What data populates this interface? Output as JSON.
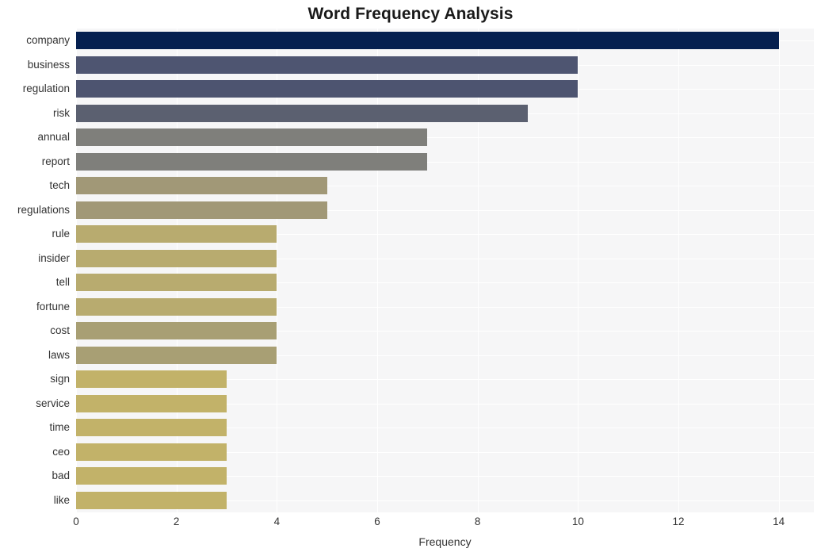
{
  "chart_data": {
    "type": "bar",
    "orientation": "horizontal",
    "title": "Word Frequency Analysis",
    "xlabel": "Frequency",
    "ylabel": "",
    "categories": [
      "company",
      "business",
      "regulation",
      "risk",
      "annual",
      "report",
      "tech",
      "regulations",
      "rule",
      "insider",
      "tell",
      "fortune",
      "cost",
      "laws",
      "sign",
      "service",
      "time",
      "ceo",
      "bad",
      "like"
    ],
    "values": [
      14,
      10,
      10,
      9,
      7,
      7,
      5,
      5,
      4,
      4,
      4,
      4,
      4,
      4,
      3,
      3,
      3,
      3,
      3,
      3
    ],
    "bar_colors": [
      "#052050",
      "#4e5571",
      "#4d5470",
      "#5b6070",
      "#7f7f7b",
      "#7f7f7b",
      "#a19877",
      "#a19877",
      "#b8ab6f",
      "#b8ab6f",
      "#b8ab6f",
      "#b8ab6f",
      "#a89f74",
      "#a89f74",
      "#c2b269",
      "#c2b269",
      "#c2b269",
      "#c2b269",
      "#c2b269",
      "#c2b269"
    ],
    "xlim": [
      0,
      14.7
    ],
    "xticks": [
      0,
      2,
      4,
      6,
      8,
      10,
      12,
      14
    ],
    "xtick_labels": [
      "0",
      "2",
      "4",
      "6",
      "8",
      "10",
      "12",
      "14"
    ],
    "grid": true,
    "grid_color": "#ffffff",
    "plot_background": "#f6f6f7",
    "figure_background": "#ffffff",
    "legend": null,
    "legend_position": "none"
  }
}
